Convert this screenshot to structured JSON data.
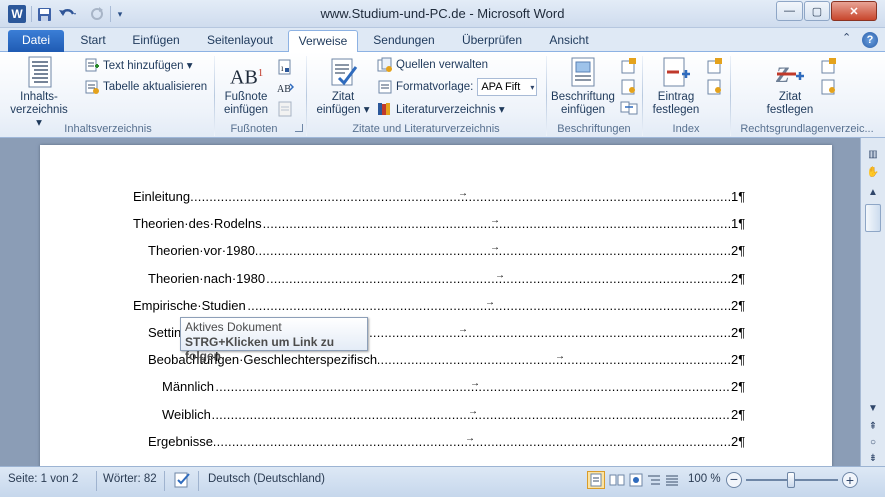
{
  "window": {
    "title": "www.Studium-und-PC.de  -  Microsoft Word",
    "app_icon": "W",
    "minimize": "—",
    "maximize": "▢",
    "close": "✕"
  },
  "qat": {
    "save_icon": "save-icon",
    "undo_icon": "undo-icon",
    "redo_icon": "redo-icon",
    "customize_icon": "customize-icon"
  },
  "tabs": [
    {
      "label": "Datei"
    },
    {
      "label": "Start"
    },
    {
      "label": "Einfügen"
    },
    {
      "label": "Seitenlayout"
    },
    {
      "label": "Verweise",
      "active": true
    },
    {
      "label": "Sendungen"
    },
    {
      "label": "Überprüfen"
    },
    {
      "label": "Ansicht"
    }
  ],
  "ribbon": {
    "toc_button": {
      "line1": "Inhalts-",
      "line2": "verzeichnis ▾"
    },
    "add_text": "Text hinzufügen ▾",
    "update_table": "Tabelle aktualisieren",
    "group_toc": "Inhaltsverzeichnis",
    "footnote_button": {
      "line1": "Fußnote",
      "line2": "einfügen"
    },
    "footnote_icon_text": "AB",
    "footnote_icon_sup": "1",
    "group_footnotes": "Fußnoten",
    "citation_button": {
      "line1": "Zitat",
      "line2": "einfügen ▾"
    },
    "manage_sources": "Quellen verwalten",
    "style_label": "Formatvorlage:",
    "style_value": "APA Fift",
    "bibliography": "Literaturverzeichnis ▾",
    "group_citations": "Zitate und Literaturverzeichnis",
    "caption_button": {
      "line1": "Beschriftung",
      "line2": "einfügen"
    },
    "group_captions": "Beschriftungen",
    "mark_entry_button": {
      "line1": "Eintrag",
      "line2": "festlegen"
    },
    "group_index": "Index",
    "mark_citation_button": {
      "line1": "Zitat",
      "line2": "festlegen"
    },
    "group_authorities": "Rechtsgrundlagenverzeic..."
  },
  "document": {
    "toc_entries": [
      {
        "text": "Einleitung",
        "page": "1¶",
        "level": 1
      },
      {
        "text": "Theorien·des·Rodelns",
        "page": "1¶",
        "level": 1
      },
      {
        "text": "Theorien·vor·1980",
        "page": "2¶",
        "level": 2
      },
      {
        "text": "Theorien·nach·1980",
        "page": "2¶",
        "level": 2
      },
      {
        "text": "Empirische·Studien",
        "page": "2¶",
        "level": 1
      },
      {
        "text": "Setting",
        "page": "2¶",
        "level": 2
      },
      {
        "text": "Beobachtungen·Geschlechterspezifisch",
        "page": "2¶",
        "level": 2
      },
      {
        "text": "Männlich",
        "page": "2¶",
        "level": 3
      },
      {
        "text": "Weiblich",
        "page": "2¶",
        "level": 3
      },
      {
        "text": "Ergebnisse",
        "page": "2¶",
        "level": 2
      }
    ],
    "tooltip": {
      "line1": "Aktives Dokument",
      "line2": "STRG+Klicken um Link zu folgen"
    }
  },
  "status": {
    "page": "Seite: 1 von 2",
    "words": "Wörter: 82",
    "language": "Deutsch (Deutschland)",
    "zoom": "100 %",
    "zoom_minus": "−",
    "zoom_plus": "+",
    "zoom_level": 1.0
  },
  "colors": {
    "accent": "#2b579a",
    "ribbon_border": "#8db2e3",
    "doc_background": "#8b9db6"
  }
}
